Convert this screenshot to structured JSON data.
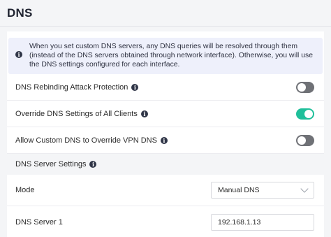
{
  "header": {
    "title": "DNS"
  },
  "notice": {
    "text": "When you set custom DNS servers, any DNS queries will be resolved through them (instead of the DNS servers obtained through network interface). Otherwise, you will use the DNS settings configured for each interface."
  },
  "toggles": [
    {
      "label": "DNS Rebinding Attack Protection",
      "state": "off"
    },
    {
      "label": "Override DNS Settings of All Clients",
      "state": "on"
    },
    {
      "label": "Allow Custom DNS to Override VPN DNS",
      "state": "off"
    }
  ],
  "server_settings": {
    "title": "DNS Server Settings",
    "mode_label": "Mode",
    "mode_value": "Manual DNS",
    "server1_label": "DNS Server 1",
    "server1_value": "192.168.1.13"
  },
  "colors": {
    "toggle_on": "#1fbf9a",
    "toggle_off": "#6f7176"
  }
}
